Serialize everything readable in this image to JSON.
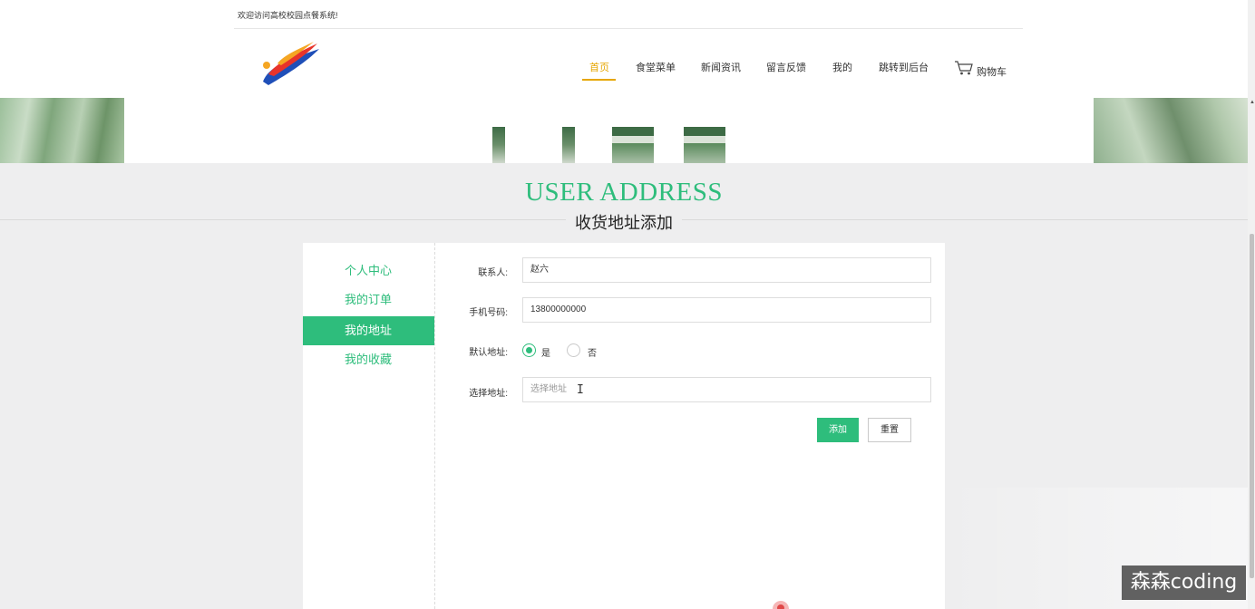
{
  "header": {
    "welcome": "欢迎访问高校校园点餐系统!",
    "nav": [
      {
        "label": "首页",
        "active": true
      },
      {
        "label": "食堂菜单",
        "active": false
      },
      {
        "label": "新闻资讯",
        "active": false
      },
      {
        "label": "留言反馈",
        "active": false
      },
      {
        "label": "我的",
        "active": false
      },
      {
        "label": "跳转到后台",
        "active": false
      }
    ],
    "cart_label": "购物车",
    "cart_icon": "cart-icon",
    "logo_icon": "brand-logo"
  },
  "section": {
    "title_en": "USER ADDRESS",
    "title_cn": "收货地址添加"
  },
  "sidebar": {
    "items": [
      {
        "label": "个人中心",
        "active": false
      },
      {
        "label": "我的订单",
        "active": false
      },
      {
        "label": "我的地址",
        "active": true
      },
      {
        "label": "我的收藏",
        "active": false
      }
    ]
  },
  "form": {
    "contact_label": "联系人:",
    "contact_value": "赵六",
    "phone_label": "手机号码:",
    "phone_value": "13800000000",
    "default_label": "默认地址:",
    "default_options": [
      {
        "label": "是",
        "checked": true
      },
      {
        "label": "否",
        "checked": false
      }
    ],
    "address_label": "选择地址:",
    "address_placeholder": "选择地址",
    "add_button": "添加",
    "reset_button": "重置"
  },
  "watermark": "森森coding",
  "colors": {
    "accent": "#2ebd7c",
    "nav_active": "#e6a600"
  }
}
